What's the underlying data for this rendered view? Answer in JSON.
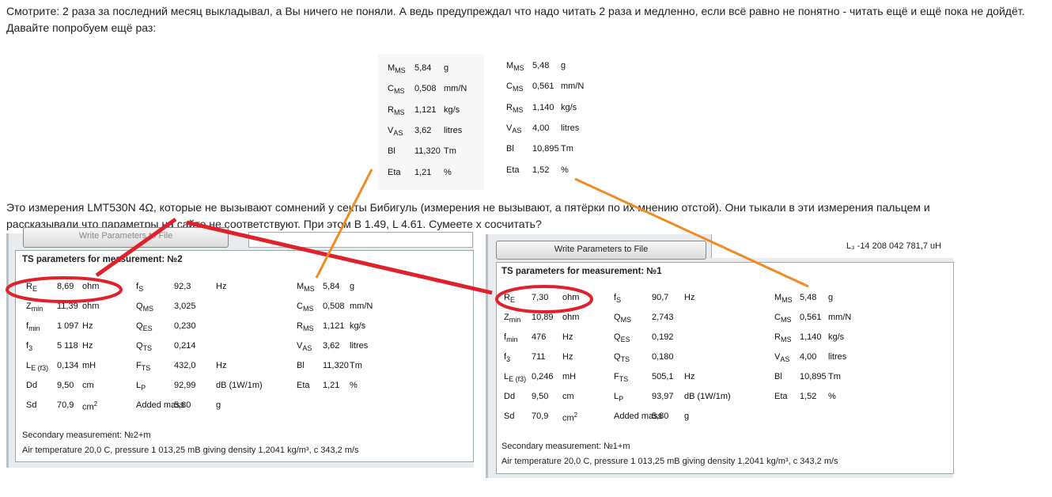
{
  "post": {
    "line1": "Смотрите: 2 раза за последний месяц выкладывал, а Вы ничего не поняли. А ведь предупреждал что надо читать 2 раза и медленно, если всё равно не понятно - читать ещё и ещё пока не дойдёт.",
    "line2": "Давайте попробуем ещё раз:",
    "line3": "Это измерения LMT530N 4Ω, которые не вызывают сомнений у секты Бибигуль (измерения не вызывают, а пятёрки по их мнению отстой). Они тыкали в эти измерения пальцем и",
    "line4": "рассказывали что параметры на сайте не соответствуют. При этом B 1.49, L 4.61. Сумеете x сосчитать?"
  },
  "snippet": {
    "left": [
      [
        "M",
        "MS",
        "5,84",
        "g"
      ],
      [
        "C",
        "MS",
        "0,508",
        "mm/N"
      ],
      [
        "R",
        "MS",
        "1,121",
        "kg/s"
      ],
      [
        "V",
        "AS",
        "3,62",
        "litres"
      ],
      [
        "Bl",
        "",
        "11,320",
        "Tm"
      ],
      [
        "Eta",
        "",
        "1,21",
        "%"
      ]
    ],
    "right": [
      [
        "M",
        "MS",
        "5,48",
        "g"
      ],
      [
        "C",
        "MS",
        "0,561",
        "mm/N"
      ],
      [
        "R",
        "MS",
        "1,140",
        "kg/s"
      ],
      [
        "V",
        "AS",
        "4,00",
        "litres"
      ],
      [
        "Bl",
        "",
        "10,895",
        "Tm"
      ],
      [
        "Eta",
        "",
        "1,52",
        "%"
      ]
    ]
  },
  "panel_left": {
    "title": "TS parameters for measurement: №2",
    "button": "Write Parameters to File",
    "cols": [
      [
        [
          "R",
          "E",
          "8,69",
          "ohm"
        ],
        [
          "Z",
          "min",
          "11,39",
          "ohm"
        ],
        [
          "f",
          "min",
          "1 097",
          "Hz"
        ],
        [
          "f",
          "3",
          "5 118",
          "Hz"
        ],
        [
          "L",
          "E (f3)",
          "0,134",
          "mH"
        ],
        [
          "Dd",
          "",
          "9,50",
          "cm"
        ],
        [
          "Sd",
          "",
          "70,9",
          "cm2"
        ]
      ],
      [
        [
          "f",
          "S",
          "92,3",
          "Hz"
        ],
        [
          "Q",
          "MS",
          "3,025",
          ""
        ],
        [
          "Q",
          "ES",
          "0,230",
          ""
        ],
        [
          "Q",
          "TS",
          "0,214",
          ""
        ],
        [
          "F",
          "TS",
          "432,0",
          "Hz"
        ],
        [
          "L",
          "P",
          "92,99",
          "dB (1W/1m)"
        ],
        [
          "Added mass",
          "",
          "5,80",
          "g"
        ]
      ],
      [
        [
          "M",
          "MS",
          "5,84",
          "g"
        ],
        [
          "C",
          "MS",
          "0,508",
          "mm/N"
        ],
        [
          "R",
          "MS",
          "1,121",
          "kg/s"
        ],
        [
          "V",
          "AS",
          "3,62",
          "litres"
        ],
        [
          "Bl",
          "",
          "11,320",
          "Tm"
        ],
        [
          "Eta",
          "",
          "1,21",
          "%"
        ]
      ]
    ],
    "secondary": "Secondary measurement: №2+m",
    "air": "Air temperature 20,0 C, pressure 1 013,25 mB giving density 1,2041 kg/m³, c 343,2 m/s"
  },
  "panel_right": {
    "title": "TS parameters for measurement: №1",
    "button": "Write Parameters to File",
    "l3": "L₃  -14 208 042 781,7  uH",
    "cols": [
      [
        [
          "R",
          "E",
          "7,30",
          "ohm"
        ],
        [
          "Z",
          "min",
          "10,89",
          "ohm"
        ],
        [
          "f",
          "min",
          "476",
          "Hz"
        ],
        [
          "f",
          "3",
          "711",
          "Hz"
        ],
        [
          "L",
          "E (f3)",
          "0,246",
          "mH"
        ],
        [
          "Dd",
          "",
          "9,50",
          "cm"
        ],
        [
          "Sd",
          "",
          "70,9",
          "cm2"
        ]
      ],
      [
        [
          "f",
          "S",
          "90,7",
          "Hz"
        ],
        [
          "Q",
          "MS",
          "2,743",
          ""
        ],
        [
          "Q",
          "ES",
          "0,192",
          ""
        ],
        [
          "Q",
          "TS",
          "0,180",
          ""
        ],
        [
          "F",
          "TS",
          "505,1",
          "Hz"
        ],
        [
          "L",
          "P",
          "93,97",
          "dB (1W/1m)"
        ],
        [
          "Added mass",
          "",
          "5,80",
          "g"
        ]
      ],
      [
        [
          "M",
          "MS",
          "5,48",
          "g"
        ],
        [
          "C",
          "MS",
          "0,561",
          "mm/N"
        ],
        [
          "R",
          "MS",
          "1,140",
          "kg/s"
        ],
        [
          "V",
          "AS",
          "4,00",
          "litres"
        ],
        [
          "Bl",
          "",
          "10,895",
          "Tm"
        ],
        [
          "Eta",
          "",
          "1,52",
          "%"
        ]
      ]
    ],
    "secondary": "Secondary measurement: №1+m",
    "air": "Air temperature 20,0 C, pressure 1 013,25 mB giving density 1,2041 kg/m³, c 343,2 m/s"
  },
  "colors": {
    "annotation_red": "#e0202a",
    "annotation_orange": "#f08a24"
  }
}
